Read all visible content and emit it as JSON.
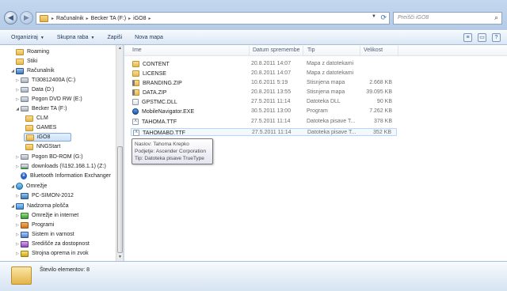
{
  "window": {
    "breadcrumb": [
      "Računalnik",
      "Becker TA (F:)",
      "iGO8"
    ],
    "search_placeholder": "Preišči iGO8"
  },
  "toolbar": {
    "organize": "Organiziraj",
    "share": "Skupna raba",
    "burn": "Zapiši",
    "new_folder": "Nova mapa"
  },
  "nav": {
    "items": [
      {
        "label": "Roaming",
        "icon": "folder-icon"
      },
      {
        "label": "Stiki",
        "icon": "folder-icon"
      },
      {
        "label": "Računalnik",
        "icon": "computer-icon"
      },
      {
        "label": "TI30812400A (C:)",
        "icon": "drive-icon"
      },
      {
        "label": "Data (D:)",
        "icon": "drive-icon"
      },
      {
        "label": "Pogon DVD RW (E:)",
        "icon": "drive-icon"
      },
      {
        "label": "Becker TA (F:)",
        "icon": "drive-icon"
      },
      {
        "label": "CLM",
        "icon": "folder-icon"
      },
      {
        "label": "GAMES",
        "icon": "folder-icon"
      },
      {
        "label": "iGO8",
        "icon": "folder-icon"
      },
      {
        "label": "NNGStart",
        "icon": "folder-icon"
      },
      {
        "label": "Pogon BD-ROM (G:)",
        "icon": "drive-icon"
      },
      {
        "label": "downloads (\\\\192.168.1.1) (Z:)",
        "icon": "network-drive-icon"
      },
      {
        "label": "Bluetooth Information Exchanger",
        "icon": "bluetooth-icon"
      },
      {
        "label": "Omrežje",
        "icon": "network-icon"
      },
      {
        "label": "PC-SIMON-2012",
        "icon": "computer-icon"
      },
      {
        "label": "Nadzorna plošča",
        "icon": "control-panel-icon"
      },
      {
        "label": "Omrežje in internet",
        "icon": "control-panel-icon"
      },
      {
        "label": "Programi",
        "icon": "control-panel-icon"
      },
      {
        "label": "Sistem in varnost",
        "icon": "control-panel-icon"
      },
      {
        "label": "Središče za dostopnost",
        "icon": "control-panel-icon"
      },
      {
        "label": "Strojna oprema in zvok",
        "icon": "control-panel-icon"
      }
    ]
  },
  "columns": {
    "name": "Ime",
    "date": "Datum spremembe",
    "type": "Tip",
    "size": "Velikost"
  },
  "files": [
    {
      "name": "CONTENT",
      "date": "20.8.2011 14:07",
      "type": "Mapa z datotekami",
      "size": "",
      "icon": "folder-icon"
    },
    {
      "name": "LICENSE",
      "date": "20.8.2011 14:07",
      "type": "Mapa z datotekami",
      "size": "",
      "icon": "folder-icon"
    },
    {
      "name": "BRANDING.ZIP",
      "date": "10.6.2011 5:19",
      "type": "Stisnjena mapa",
      "size": "2.668 KB",
      "icon": "zip-icon"
    },
    {
      "name": "DATA.ZIP",
      "date": "20.8.2011 13:55",
      "type": "Stisnjena mapa",
      "size": "39.095 KB",
      "icon": "zip-icon"
    },
    {
      "name": "GPSTMC.DLL",
      "date": "27.5.2011 11:14",
      "type": "Datoteka DLL",
      "size": "90 KB",
      "icon": "dll-icon"
    },
    {
      "name": "MobileNavigator.EXE",
      "date": "30.5.2011 13:00",
      "type": "Program",
      "size": "7.262 KB",
      "icon": "exe-icon"
    },
    {
      "name": "TAHOMA.TTF",
      "date": "27.5.2011 11:14",
      "type": "Datoteka pisave T...",
      "size": "378 KB",
      "icon": "font-icon"
    },
    {
      "name": "TAHOMABD.TTF",
      "date": "27.5.2011 11:14",
      "type": "Datoteka pisave T...",
      "size": "352 KB",
      "icon": "font-icon"
    }
  ],
  "tooltip": {
    "line1": "Naslov: Tahoma Krepko",
    "line2": "Podjetje: Ascender Corporation",
    "line3": "Tip: Datoteka pisave TrueType"
  },
  "details": {
    "status": "Število elementov: 8"
  }
}
